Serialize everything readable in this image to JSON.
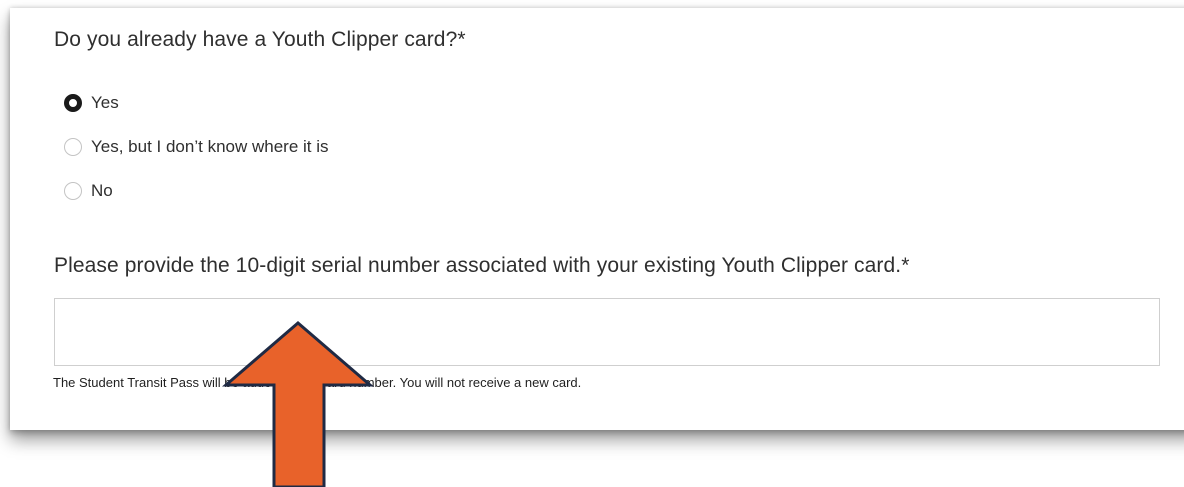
{
  "question": {
    "text": "Do you already have a Youth Clipper card?*"
  },
  "options": [
    {
      "label": "Yes",
      "checked": true
    },
    {
      "label": "Yes, but I don’t know where it is",
      "checked": false
    },
    {
      "label": "No",
      "checked": false
    }
  ],
  "serial": {
    "label": "Please provide the 10-digit serial number associated with your existing Youth Clipper card.*",
    "value": "",
    "placeholder": "",
    "help": "The Student Transit Pass will be added to this card number. You will not receive a new card."
  },
  "annotation": {
    "icon": "arrow-up-icon",
    "fill_color": "#E8622A",
    "stroke_color": "#1F2A44"
  }
}
